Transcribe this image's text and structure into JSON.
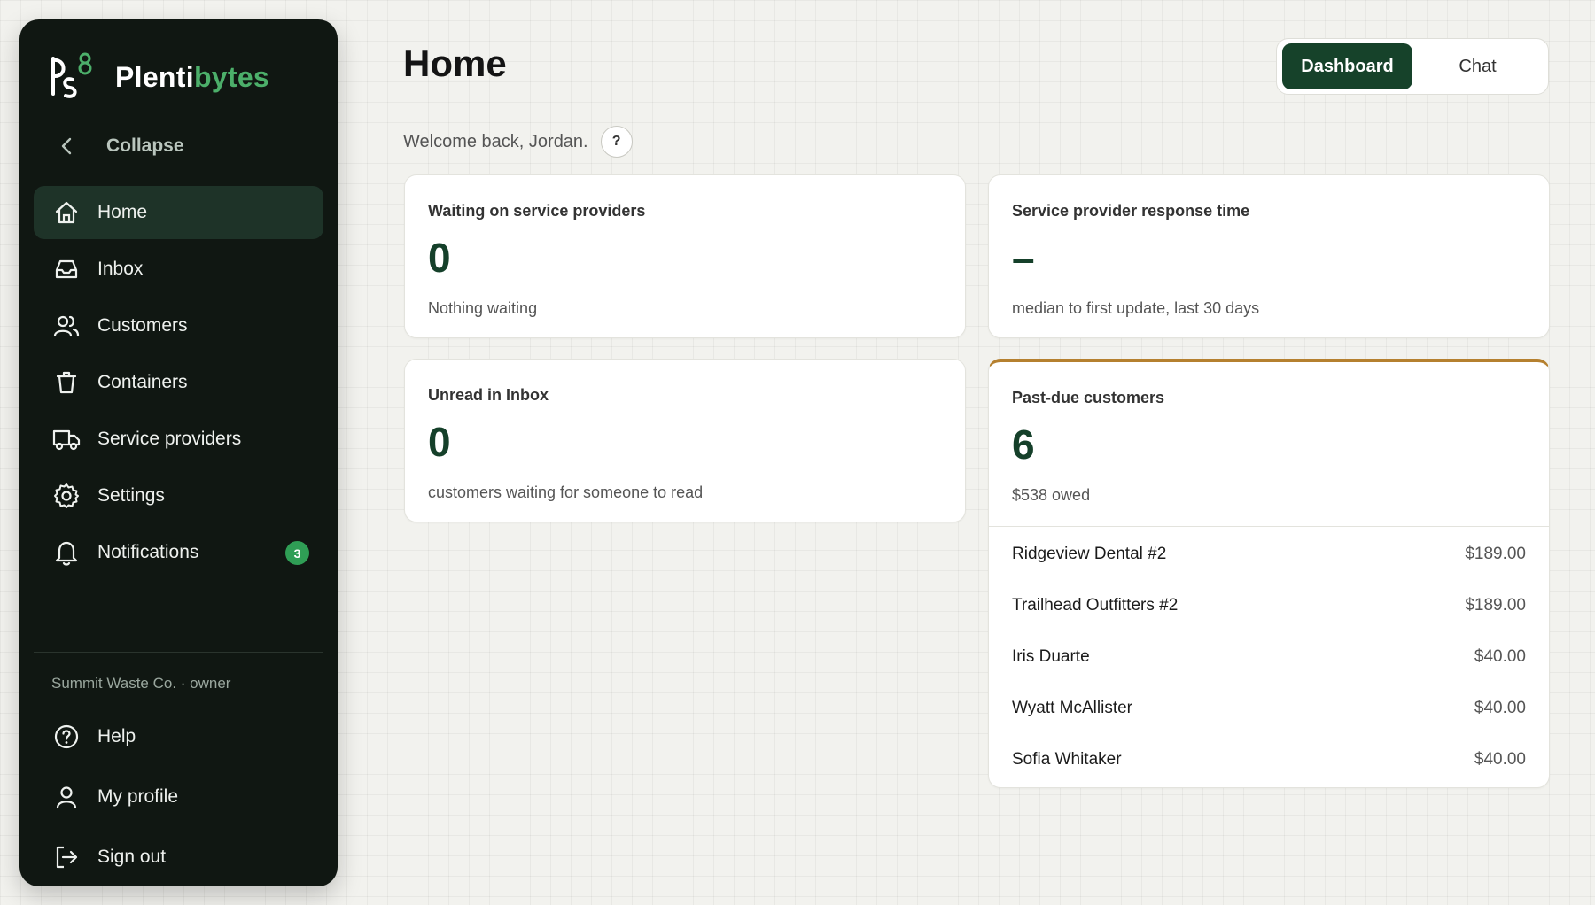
{
  "brand": {
    "part1": "Plenti",
    "part2": "bytes",
    "accent": "#4caf6a"
  },
  "sidebar": {
    "collapse_label": "Collapse",
    "items": [
      {
        "label": "Home",
        "icon": "home-icon",
        "active": true
      },
      {
        "label": "Inbox",
        "icon": "inbox-icon"
      },
      {
        "label": "Customers",
        "icon": "users-icon"
      },
      {
        "label": "Containers",
        "icon": "trash-bin-icon"
      },
      {
        "label": "Service providers",
        "icon": "truck-icon"
      },
      {
        "label": "Settings",
        "icon": "gear-icon"
      },
      {
        "label": "Notifications",
        "icon": "bell-icon",
        "badge": "3"
      }
    ],
    "org": "Summit Waste Co. · owner",
    "bottom": [
      {
        "label": "Help",
        "icon": "help-circle-icon"
      },
      {
        "label": "My profile",
        "icon": "user-icon"
      },
      {
        "label": "Sign out",
        "icon": "sign-out-icon"
      }
    ]
  },
  "header": {
    "title": "Home",
    "welcome": "Welcome back, Jordan.",
    "help": "?",
    "tabs": [
      {
        "label": "Dashboard",
        "active": true
      },
      {
        "label": "Chat"
      }
    ]
  },
  "cards": {
    "waiting": {
      "title": "Waiting on service providers",
      "value": "0",
      "sub": "Nothing waiting"
    },
    "response": {
      "title": "Service provider response time",
      "value": "–",
      "sub": "median to first update, last 30 days"
    },
    "unread": {
      "title": "Unread in Inbox",
      "value": "0",
      "sub": "customers waiting for someone to read"
    },
    "pastdue": {
      "title": "Past-due customers",
      "value": "6",
      "sub": "$538 owed",
      "accent": "#b5802f",
      "rows": [
        {
          "name": "Ridgeview Dental #2",
          "amount": "$189.00"
        },
        {
          "name": "Trailhead Outfitters #2",
          "amount": "$189.00"
        },
        {
          "name": "Iris Duarte",
          "amount": "$40.00"
        },
        {
          "name": "Wyatt McAllister",
          "amount": "$40.00"
        },
        {
          "name": "Sofia Whitaker",
          "amount": "$40.00"
        }
      ]
    }
  },
  "colors": {
    "sidebar_bg": "#101712",
    "primary": "#16422a",
    "badge": "#2f9e55"
  }
}
